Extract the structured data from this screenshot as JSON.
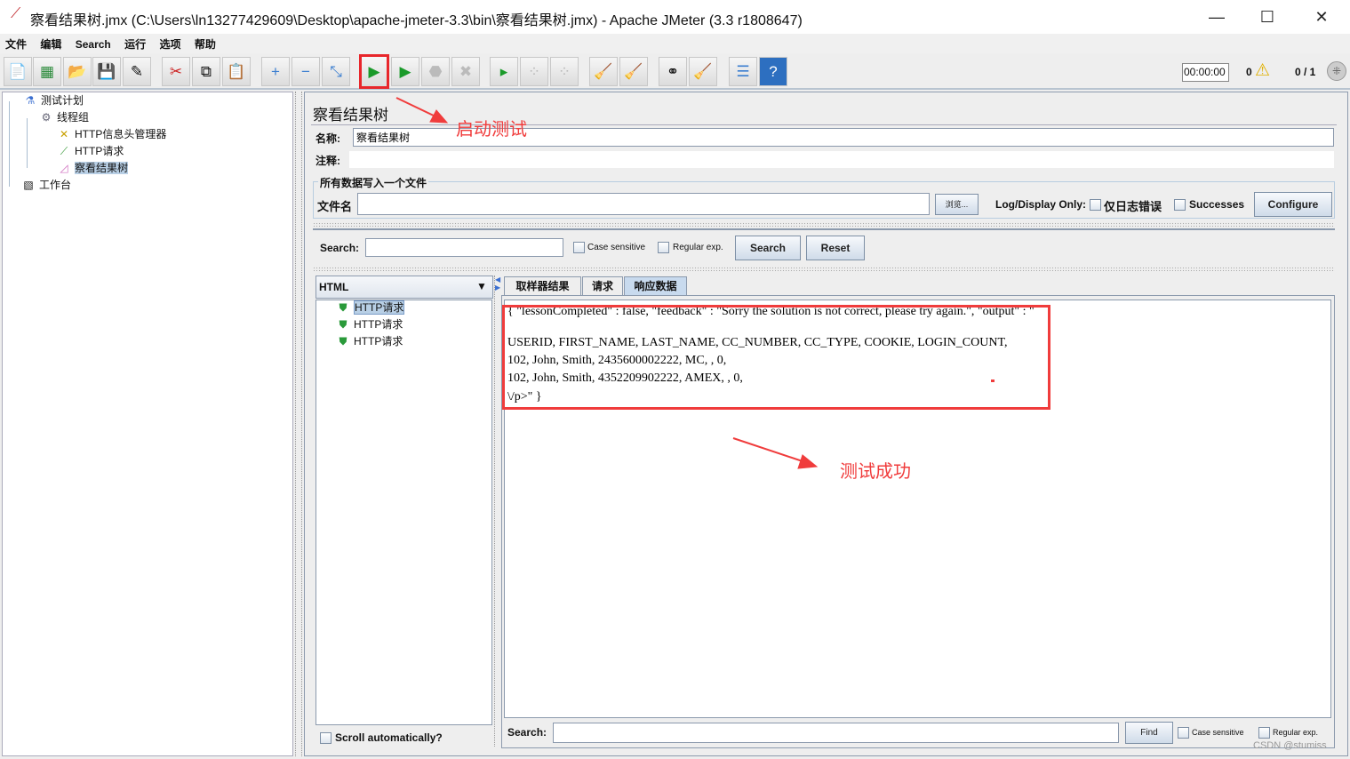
{
  "window": {
    "title": "察看结果树.jmx (C:\\Users\\ln13277429609\\Desktop\\apache-jmeter-3.3\\bin\\察看结果树.jmx) - Apache JMeter (3.3 r1808647)"
  },
  "menu": [
    "文件",
    "编辑",
    "Search",
    "运行",
    "选项",
    "帮助"
  ],
  "toolbar": {
    "timer": "00:00:00",
    "warnings": "0",
    "threads": "0 / 1",
    "start_highlight_color": "#e8262b"
  },
  "tree": {
    "items": [
      {
        "label": "测试计划",
        "icon": "flask-icon"
      },
      {
        "label": "线程组",
        "icon": "gear-icon"
      },
      {
        "label": "HTTP信息头管理器",
        "icon": "tools-icon"
      },
      {
        "label": "HTTP请求",
        "icon": "pipette-icon"
      },
      {
        "label": "察看结果树",
        "icon": "chart-icon",
        "selected": true
      },
      {
        "label": "工作台",
        "icon": "notepad-icon"
      }
    ]
  },
  "panel": {
    "title": "察看结果树",
    "name_label": "名称:",
    "name_value": "察看结果树",
    "comment_label": "注释:",
    "comment_value": "",
    "file_group": "所有数据写入一个文件",
    "file_label": "文件名",
    "file_value": "",
    "browse": "浏览...",
    "log_display": "Log/Display Only:",
    "errors_only": "仅日志错误",
    "successes": "Successes",
    "configure": "Configure"
  },
  "search": {
    "label": "Search:",
    "value": "",
    "case_sensitive": "Case sensitive",
    "regex": "Regular exp.",
    "search_btn": "Search",
    "reset_btn": "Reset"
  },
  "results": {
    "renderer": "HTML",
    "samples": [
      "HTTP请求",
      "HTTP请求",
      "HTTP请求"
    ],
    "scroll_auto": "Scroll automatically?",
    "tabs": [
      "取样器结果",
      "请求",
      "响应数据"
    ],
    "active_tab": "响应数据",
    "response_lines": [
      "{ \"lessonCompleted\" : false, \"feedback\" : \"Sorry the solution is not correct, please try again.\", \"output\" : \"",
      "USERID, FIRST_NAME, LAST_NAME, CC_NUMBER, CC_TYPE, COOKIE, LOGIN_COUNT,",
      "102, John, Smith, 2435600002222, MC, , 0,",
      "102, John, Smith, 4352209902222, AMEX, , 0,",
      "\\/p>\" }"
    ],
    "find_label": "Search:",
    "find_value": "",
    "find_btn": "Find",
    "case_sensitive": "Case sensitive",
    "regex": "Regular exp."
  },
  "annotations": {
    "start": "启动测试",
    "success": "测试成功",
    "color": "#f03c3c"
  },
  "watermark": "CSDN @stumiss"
}
